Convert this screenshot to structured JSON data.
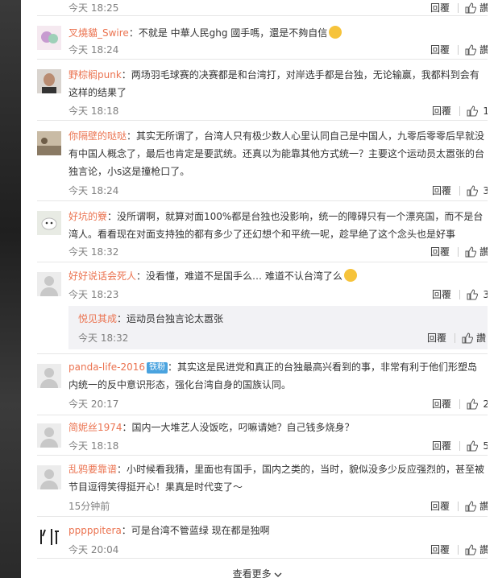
{
  "top": {
    "time": "今天 18:25",
    "reply": "回覆",
    "like": "讚"
  },
  "comments": [
    {
      "user": "叉燒貓_Swire",
      "text": "：不就是 中華人民ghg 國手嗎，還是不夠自信",
      "time": "今天 18:24",
      "reply": "回覆",
      "like": "讚"
    },
    {
      "user": "野棕榈punk",
      "text": "：两场羽毛球赛的决赛都是和台湾打，对岸选手都是台独，无论输赢，我都料到会有这样的结果了",
      "time": "今天 18:18",
      "reply": "回覆",
      "like": "1"
    },
    {
      "user": "你隔壁的哒哒",
      "text": "：其实无所谓了，台湾人只有极少数人心里认同自己是中国人，九零后零零后早就没有中国人概念了，最后也肯定是要武统。还真以为能靠其他方式统一？主要这个运动员太嚣张的台独言论，小s这是撞枪口了。",
      "time": "今天 18:24",
      "reply": "回覆",
      "like": "3"
    },
    {
      "user": "好坑的簝",
      "text": "：没所谓啊，就算对面100%都是台独也没影响，统一的障碍只有一个漂亮国，而不是台湾人。看看现在对面支持独的都有多少了还幻想个和平统一呢，趁早绝了这个念头也是好事",
      "time": "今天 18:32",
      "reply": "回覆",
      "like": "讚"
    },
    {
      "user": "好好说话会死人",
      "text": "：没看懂，难道不是国手么… 难道不认台湾了么",
      "time": "今天 18:23",
      "reply": "回覆",
      "like": "3",
      "sub": {
        "user": "悦见其成",
        "text": "：运动员台独言论太嚣张",
        "time": "今天 18:32",
        "reply": "回覆",
        "like": "讚"
      }
    },
    {
      "user": "panda-life-2016",
      "badge": "铁粉",
      "text": "：其实这是民进党和真正的台独最高兴看到的事，非常有利于他们形塑岛内统一的反中意识形态，强化台湾自身的国族认同。",
      "time": "今天 20:17",
      "reply": "回覆",
      "like": "2"
    },
    {
      "user": "简妮丝1974",
      "text": "：国内一大堆艺人没饭吃，叼嘛请她？自己钱多烧身？",
      "time": "今天 18:18",
      "reply": "回覆",
      "like": "5"
    },
    {
      "user": "乱鸦要靠谱",
      "text": "：小时候看我猜，里面也有国手，国内之类的，当时，貌似没多少反应强烈的，甚至被节目逗得笑得挺开心！果真是时代变了～",
      "time": "15分钟前",
      "reply": "回覆",
      "like": "讚"
    },
    {
      "user": "pppppitera",
      "text": "：可是台湾不管蓝绿 现在都是独啊",
      "time": "今天 20:04",
      "reply": "回覆",
      "like": "讚"
    }
  ],
  "more": "查看更多",
  "colors": {
    "username": "#eb7350",
    "time": "#808080",
    "sub_bg": "#f2f2f5"
  }
}
